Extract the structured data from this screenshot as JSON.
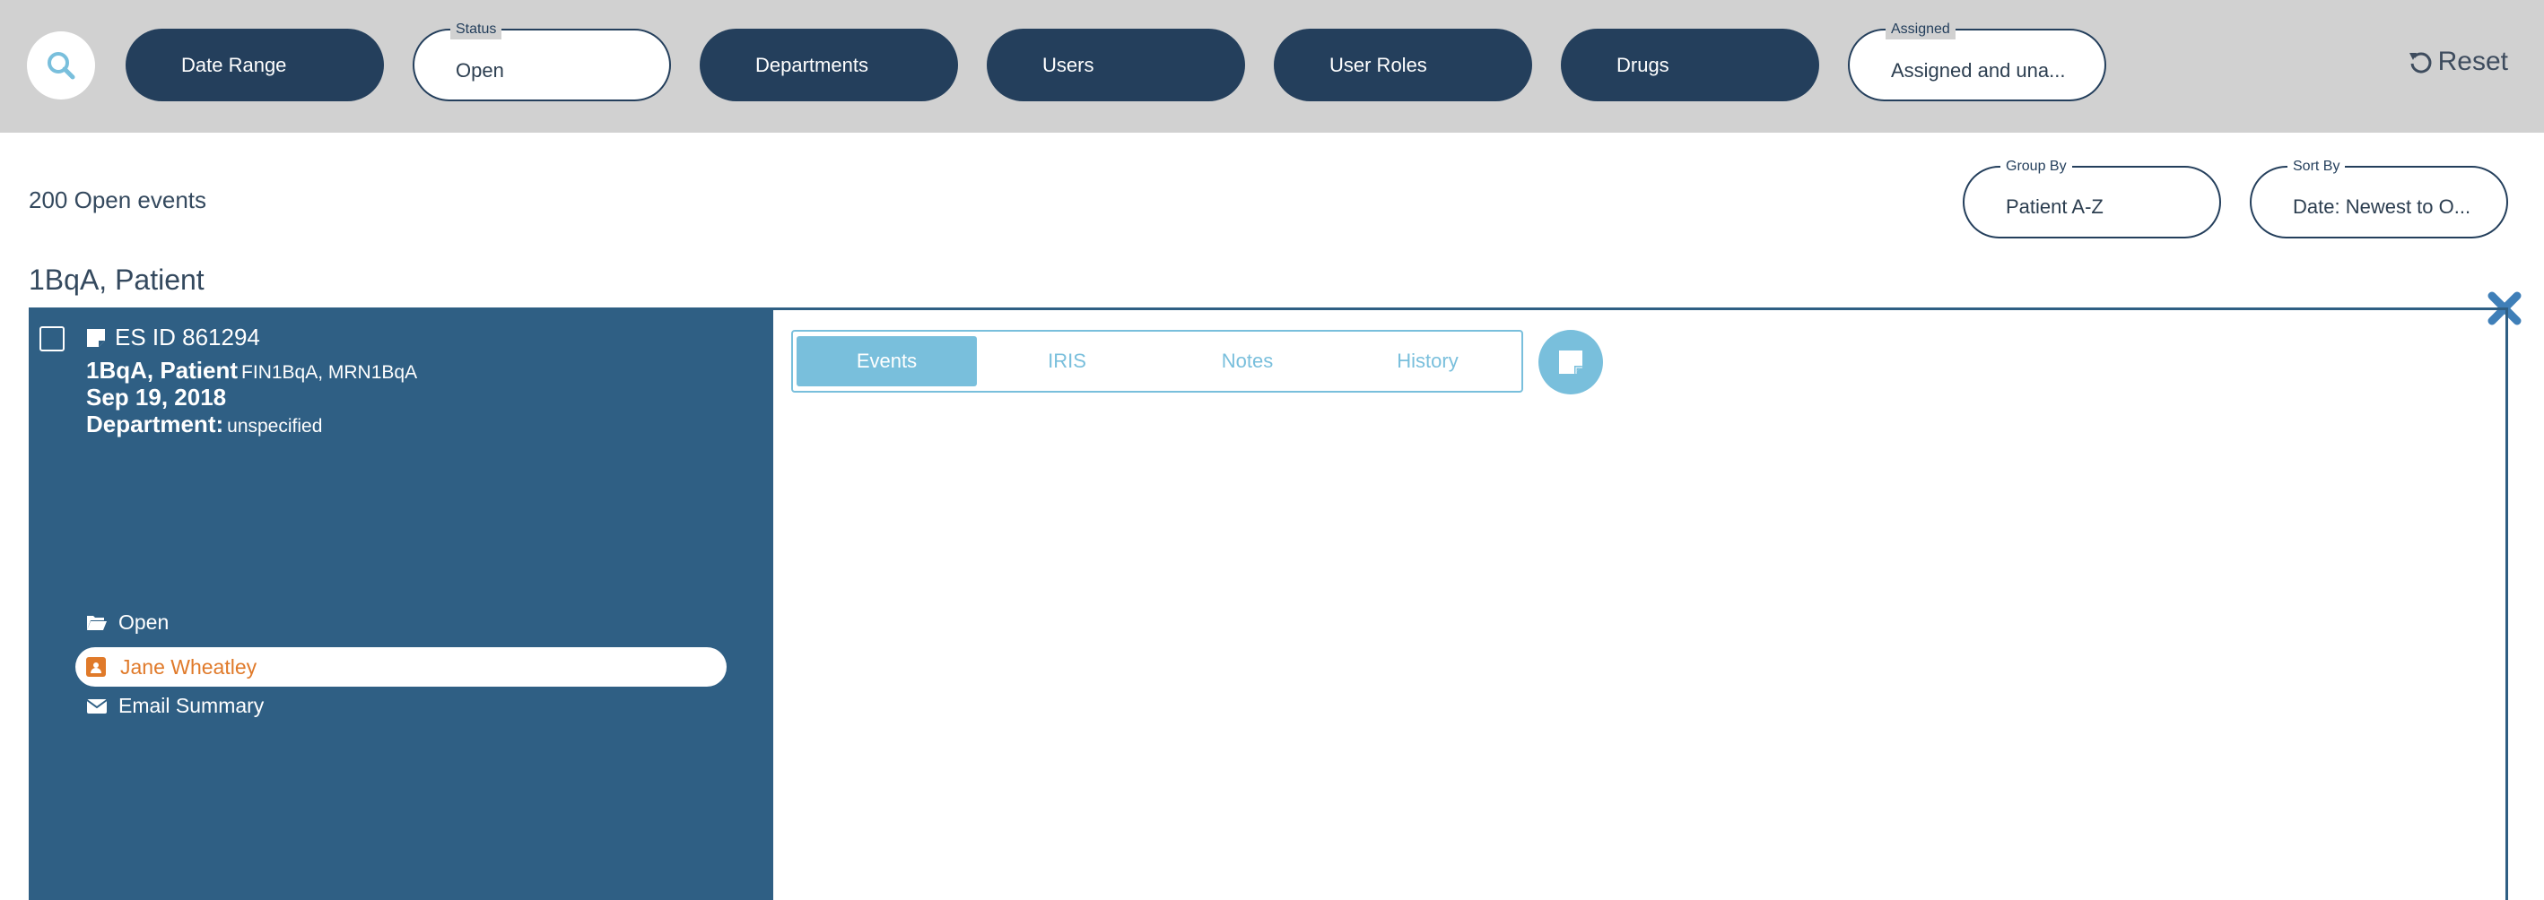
{
  "filters": {
    "date_range": "Date Range",
    "status": {
      "legend": "Status",
      "value": "Open"
    },
    "departments": "Departments",
    "users": "Users",
    "user_roles": "User Roles",
    "drugs": "Drugs",
    "assigned": {
      "legend": "Assigned",
      "value": "Assigned and una..."
    },
    "reset": "Reset"
  },
  "summary": "200 Open events",
  "group_by": {
    "legend": "Group By",
    "value": "Patient A-Z"
  },
  "sort_by": {
    "legend": "Sort By",
    "value": "Date: Newest to O..."
  },
  "group_heading": "1BqA, Patient",
  "event": {
    "es_id": "ES ID 861294",
    "patient": "1BqA, Patient",
    "ids": "FIN1BqA, MRN1BqA",
    "date": "Sep 19, 2018",
    "department_label": "Department:",
    "department_value": "unspecified",
    "status_action": "Open",
    "assignee": "Jane Wheatley",
    "email_action": "Email Summary"
  },
  "tabs": [
    "Events",
    "IRIS",
    "Notes",
    "History"
  ],
  "colors": {
    "topbar": "#d1d1d1",
    "navy": "#243f5c",
    "card": "#2f5f84",
    "accent": "#79bfdc",
    "assignee": "#e07a2a"
  },
  "icons": [
    "search-icon",
    "reset-icon",
    "note-icon",
    "folder-open-icon",
    "user-badge-icon",
    "envelope-icon",
    "close-icon"
  ]
}
